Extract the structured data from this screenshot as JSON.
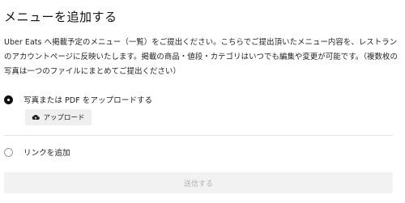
{
  "page": {
    "title": "メニューを追加する",
    "description": "Uber Eats へ掲載予定のメニュー（一覧）をご提出ください。こちらでご提出頂いたメニュー内容を、レストランのアカウントページに反映いたします。掲載の商品・値段・カテゴリはいつでも編集や変更が可能です。（複数枚の写真は一つのファイルにまとめてご提出ください）"
  },
  "options": [
    {
      "label": "写真または PDF をアップロードする",
      "selected": true
    },
    {
      "label": "リンクを追加",
      "selected": false
    }
  ],
  "upload": {
    "label": "アップロード",
    "icon": "cloud-upload-icon"
  },
  "submit": {
    "label": "送信する",
    "disabled": true
  }
}
